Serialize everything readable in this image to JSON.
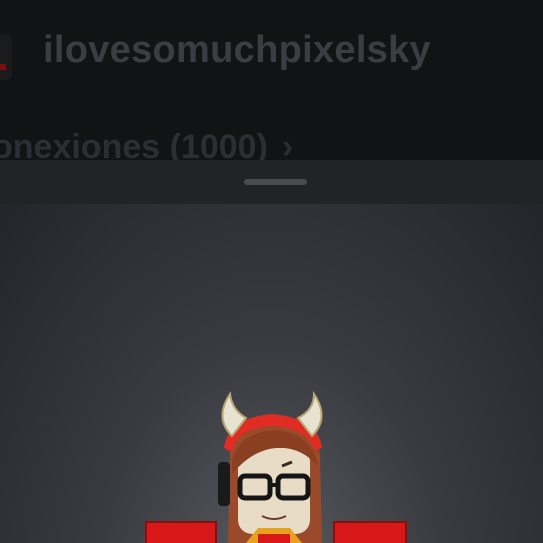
{
  "profile": {
    "username": "ilovesomuchpixelsky",
    "connections_label": "onexiones (1000)",
    "connections_chevron": "›"
  },
  "icons": {
    "drag_handle": "drag-handle",
    "chevron": "chevron-right-icon"
  },
  "colors": {
    "background": "#111214",
    "sheet": "#1d1e21",
    "username_text": "#3c3d42",
    "connections_text": "#2d2e33",
    "avatar_red": "#d81818",
    "avatar_skin": "#e9dcc7",
    "avatar_hair": "#9a4a2a"
  }
}
